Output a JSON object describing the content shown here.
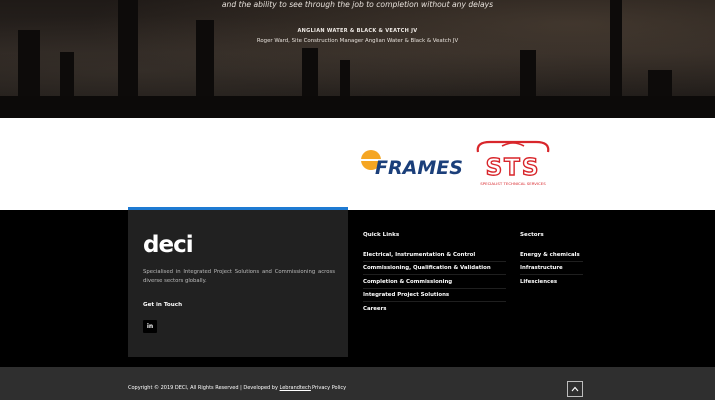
{
  "testimonial": {
    "quote": "and the ability to see through the job to completion without any delays",
    "company": "ANGLIAN WATER & BLACK & VEATCH JV",
    "person": "Roger Ward, Site Construction Manager Anglian Water & Black & Veatch JV"
  },
  "partners": {
    "frames": {
      "name": "FRAMES"
    },
    "sts": {
      "name": "STS",
      "subtitle": "SPECIALIST TECHNICAL SERVICES"
    }
  },
  "brand": {
    "logo": "deci",
    "tagline": "Specialised in Integrated Project Solutions and Commissioning across diverse sectors globally.",
    "get_in_touch": "Get in Touch",
    "social_icon": "linkedin-icon",
    "social_label": "in",
    "accent": "#1e7ad2"
  },
  "quick_links": {
    "title": "Quick Links",
    "items": [
      "Electrical, Instrumentation & Control",
      "Commissioning, Qualification & Validation",
      "Completion & Commissioning",
      "Integrated Project Solutions",
      "Careers"
    ]
  },
  "sectors": {
    "title": "Sectors",
    "items": [
      "Energy & chemicals",
      "Infrastructure",
      "Lifesciences"
    ]
  },
  "footer_bar": {
    "copyright": "Copyright © 2019 DECI, All Rights Reserved | Developed by ",
    "developer": "Lebrandtech",
    "privacy": "Privacy Policy",
    "to_top_icon": "chevron-up-icon"
  }
}
